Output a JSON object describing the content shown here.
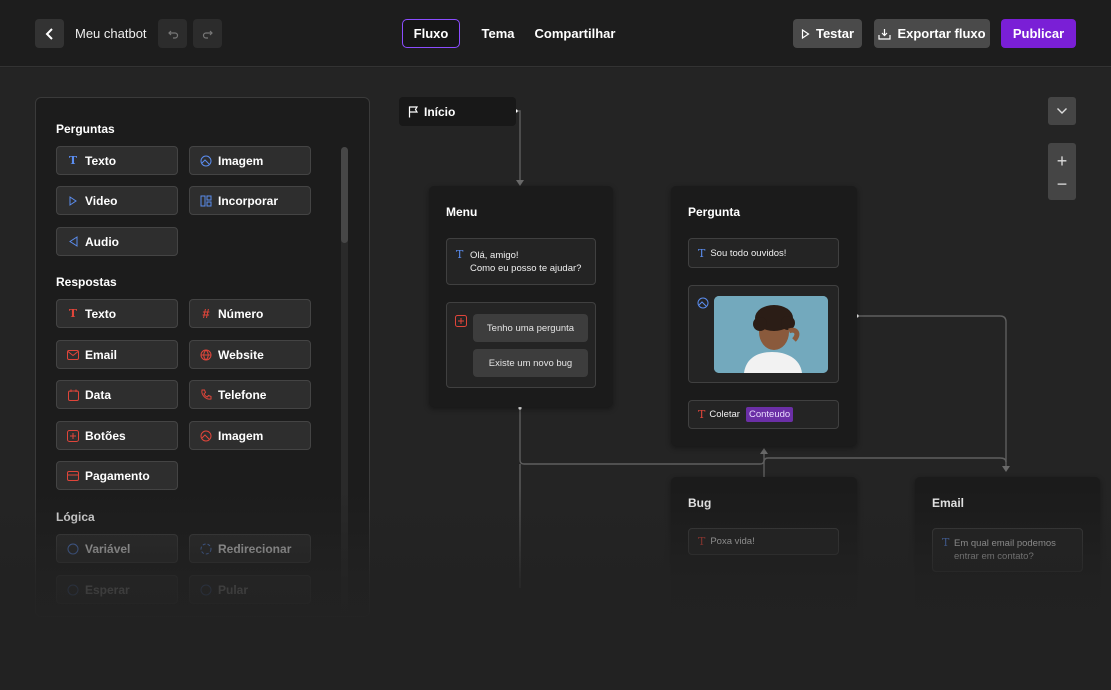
{
  "topbar": {
    "title": "Meu chatbot",
    "tabs": [
      {
        "label": "Fluxo",
        "active": true
      },
      {
        "label": "Tema",
        "active": false
      },
      {
        "label": "Compartilhar",
        "active": false
      }
    ],
    "test_label": "Testar",
    "export_label": "Exportar fluxo",
    "publish_label": "Publicar"
  },
  "sidebar": {
    "questions_heading": "Perguntas",
    "questions": [
      {
        "label": "Texto",
        "icon": "text-icon",
        "color": "#5b8def"
      },
      {
        "label": "Imagem",
        "icon": "image-icon",
        "color": "#5b8def"
      },
      {
        "label": "Video",
        "icon": "play-icon",
        "color": "#5b8def"
      },
      {
        "label": "Incorporar",
        "icon": "embed-icon",
        "color": "#5b8def"
      },
      {
        "label": "Audio",
        "icon": "audio-icon",
        "color": "#5b8def"
      }
    ],
    "answers_heading": "Respostas",
    "answers": [
      {
        "label": "Texto",
        "icon": "text-icon",
        "color": "#e0453a"
      },
      {
        "label": "Número",
        "icon": "hash-icon",
        "color": "#e0453a"
      },
      {
        "label": "Email",
        "icon": "mail-icon",
        "color": "#e0453a"
      },
      {
        "label": "Website",
        "icon": "globe-icon",
        "color": "#e0453a"
      },
      {
        "label": "Data",
        "icon": "calendar-icon",
        "color": "#e0453a"
      },
      {
        "label": "Telefone",
        "icon": "phone-icon",
        "color": "#e0453a"
      },
      {
        "label": "Botões",
        "icon": "buttons-icon",
        "color": "#e0453a"
      },
      {
        "label": "Imagem",
        "icon": "image-icon",
        "color": "#e0453a"
      },
      {
        "label": "Pagamento",
        "icon": "card-icon",
        "color": "#e0453a"
      }
    ],
    "logic_heading": "Lógica",
    "logic": [
      {
        "label": "Variável",
        "icon": "variable-icon"
      },
      {
        "label": "Redirecionar",
        "icon": "redirect-icon"
      },
      {
        "label": "Esperar",
        "icon": "wait-icon"
      },
      {
        "label": "Pular",
        "icon": "jump-icon"
      }
    ]
  },
  "flow": {
    "start_label": "Início",
    "menu": {
      "title": "Menu",
      "message_line1": "Olá, amigo!",
      "message_line2": "Como eu posso te ajudar?",
      "choices": [
        "Tenho uma pergunta",
        "Existe um novo bug"
      ]
    },
    "pergunta": {
      "title": "Pergunta",
      "message": "Sou todo ouvidos!",
      "collect_label": "Coletar",
      "collect_variable": "Conteudo"
    },
    "bug": {
      "title": "Bug",
      "message": "Poxa vida!"
    },
    "email": {
      "title": "Email",
      "message_line1": "Em qual email podemos",
      "message_line2": "entrar em contato?"
    }
  },
  "colors": {
    "accent": "#7a1fd6",
    "question_icon": "#5b8def",
    "answer_icon": "#e0453a",
    "tag": "#6b2fa6"
  }
}
